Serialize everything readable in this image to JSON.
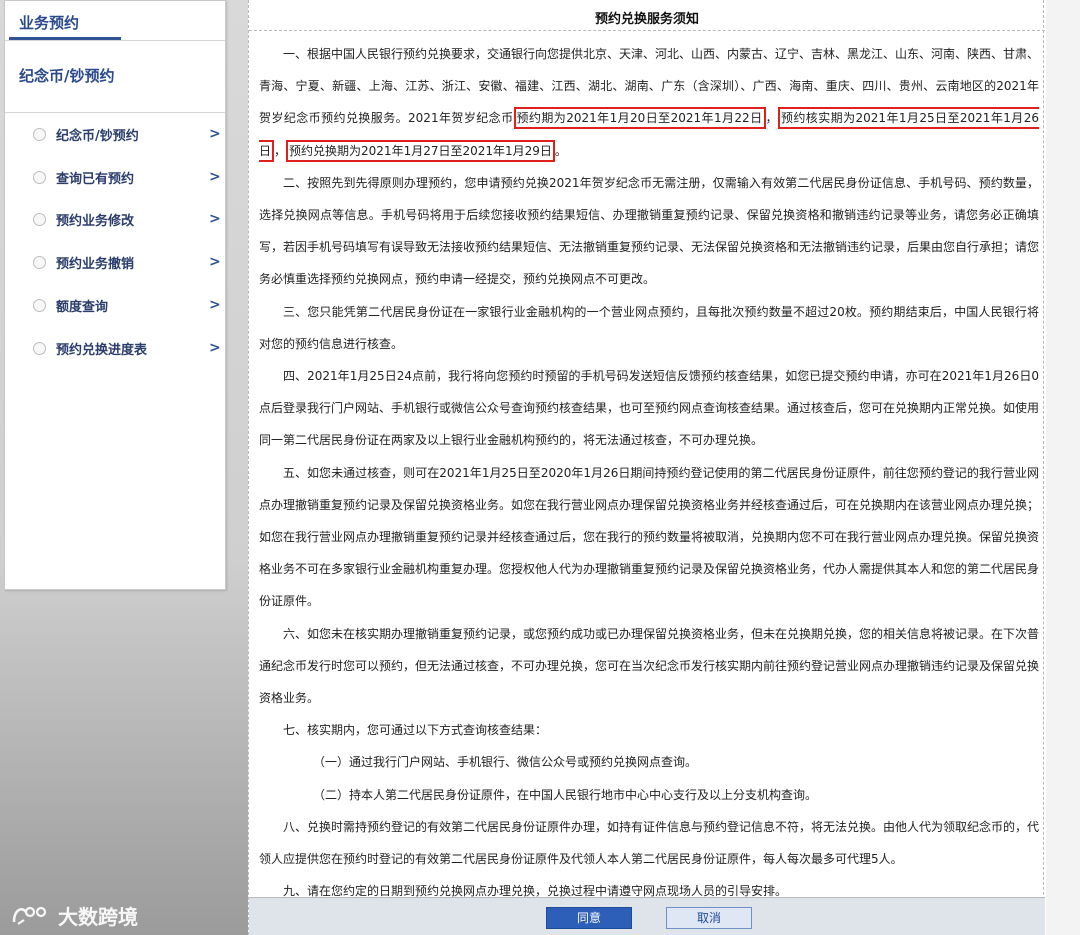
{
  "sidebar": {
    "header_title": "业务预约",
    "section_title": "纪念币/钞预约",
    "items": [
      {
        "label": "纪念币/钞预约",
        "arrow": ">"
      },
      {
        "label": "查询已有预约",
        "arrow": ">"
      },
      {
        "label": "预约业务修改",
        "arrow": ">"
      },
      {
        "label": "预约业务撤销",
        "arrow": ">"
      },
      {
        "label": "额度查询",
        "arrow": ">"
      },
      {
        "label": "预约兑换进度表",
        "arrow": ">"
      }
    ]
  },
  "panel": {
    "title": "预约兑换服务须知",
    "p1_a": "一、根据中国人民银行预约兑换要求，交通银行向您提供北京、天津、河北、山西、内蒙古、辽宁、吉林、黑龙江、山东、河南、陕西、甘肃、青海、宁夏、新疆、上海、江苏、浙江、安徽、福建、江西、湖北、湖南、广东（含深圳）、广西、海南、重庆、四川、贵州、云南地区的2021年贺岁纪念币预约兑换服务。2021年贺岁纪念币",
    "p1_h1": "预约期为2021年1月20日至2021年1月22日",
    "p1_b": "，",
    "p1_h2": "预约核实期为2021年1月25日至2021年1月26日",
    "p1_c": "，",
    "p1_h3": "预约兑换期为2021年1月27日至2021年1月29日",
    "p1_d": "。",
    "p2": "二、按照先到先得原则办理预约，您申请预约兑换2021年贺岁纪念币无需注册，仅需输入有效第二代居民身份证信息、手机号码、预约数量，选择兑换网点等信息。手机号码将用于后续您接收预约结果短信、办理撤销重复预约记录、保留兑换资格和撤销违约记录等业务，请您务必正确填写，若因手机号码填写有误导致无法接收预约结果短信、无法撤销重复预约记录、无法保留兑换资格和无法撤销违约记录，后果由您自行承担；请您务必慎重选择预约兑换网点，预约申请一经提交，预约兑换网点不可更改。",
    "p3": "三、您只能凭第二代居民身份证在一家银行业金融机构的一个营业网点预约，且每批次预约数量不超过20枚。预约期结束后，中国人民银行将对您的预约信息进行核查。",
    "p4": "四、2021年1月25日24点前，我行将向您预约时预留的手机号码发送短信反馈预约核查结果，如您已提交预约申请，亦可在2021年1月26日0点后登录我行门户网站、手机银行或微信公众号查询预约核查结果，也可至预约网点查询核查结果。通过核查后，您可在兑换期内正常兑换。如使用同一第二代居民身份证在两家及以上银行业金融机构预约的，将无法通过核查，不可办理兑换。",
    "p5": "五、如您未通过核查，则可在2021年1月25日至2020年1月26日期间持预约登记使用的第二代居民身份证原件，前往您预约登记的我行营业网点办理撤销重复预约记录及保留兑换资格业务。如您在我行营业网点办理保留兑换资格业务并经核查通过后，可在兑换期内在该营业网点办理兑换；如您在我行营业网点办理撤销重复预约记录并经核查通过后，您在我行的预约数量将被取消，兑换期内您不可在我行营业网点办理兑换。保留兑换资格业务不可在多家银行业金融机构重复办理。您授权他人代为办理撤销重复预约记录及保留兑换资格业务，代办人需提供其本人和您的第二代居民身份证原件。",
    "p6": "六、如您未在核实期办理撤销重复预约记录，或您预约成功或已办理保留兑换资格业务，但未在兑换期兑换，您的相关信息将被记录。在下次普通纪念币发行时您可以预约，但无法通过核查，不可办理兑换，您可在当次纪念币发行核实期内前往预约登记营业网点办理撤销违约记录及保留兑换资格业务。",
    "p7": "七、核实期内，您可通过以下方式查询核查结果：",
    "p7_1": "（一）通过我行门户网站、手机银行、微信公众号或预约兑换网点查询。",
    "p7_2": "（二）持本人第二代居民身份证原件，在中国人民银行地市中心中心支行及以上分支机构查询。",
    "p8": "八、兑换时需持预约登记的有效第二代居民身份证原件办理，如持有证件信息与预约登记信息不符，将无法兑换。由他人代为领取纪念币的，代领人应提供您在预约时登记的有效第二代居民身份证原件及代领人本人第二代居民身份证原件，每人每次最多可代理5人。",
    "p9": "九、请在您约定的日期到预约兑换网点办理兑换，兑换过程中请遵守网点现场人员的引导安排。"
  },
  "buttons": {
    "agree": "同意",
    "cancel": "取消"
  },
  "watermark": {
    "text": "大数跨境"
  },
  "colors": {
    "accent": "#2f5597",
    "highlight_border": "#e0201c",
    "agree_button": "#2d5fb8"
  }
}
